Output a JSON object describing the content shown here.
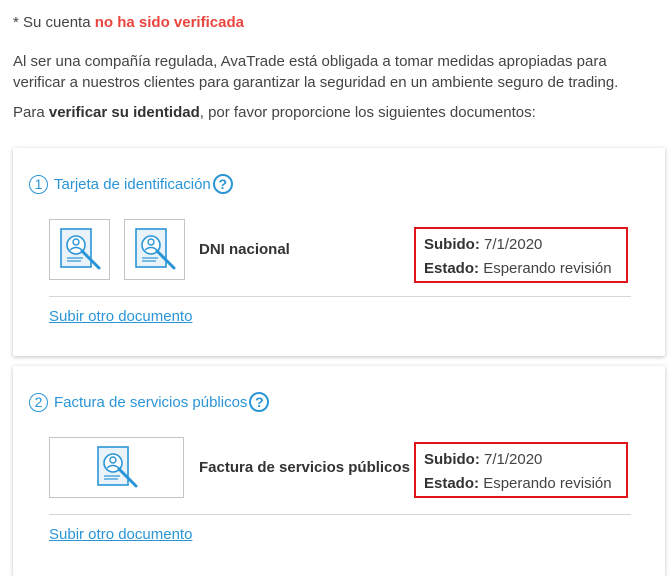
{
  "status": {
    "prefix": "* Su cuenta ",
    "warning": "no ha sido verificada"
  },
  "intro": "Al ser una compañía regulada, AvaTrade está obligada a tomar medidas apropiadas para verificar a nuestros clientes para garantizar la seguridad en un ambiente seguro de trading.",
  "request": {
    "before": "Para ",
    "bold": "verificar su identidad",
    "after": ", por favor proporcione los siguientes documentos:"
  },
  "sections": [
    {
      "number": "1",
      "title": "Tarjeta de identificación",
      "help": "?",
      "document_label": "DNI nacional",
      "uploaded_label": "Subido:",
      "uploaded_value": "7/1/2020",
      "state_label": "Estado:",
      "state_value": "Esperando revisión",
      "upload_link": "Subir otro documento"
    },
    {
      "number": "2",
      "title": "Factura de servicios públicos",
      "help": "?",
      "document_label": "Factura de servicios públicos",
      "uploaded_label": "Subido:",
      "uploaded_value": "7/1/2020",
      "state_label": "Estado:",
      "state_value": "Esperando revisión",
      "upload_link": "Subir otro documento"
    }
  ],
  "icons": {
    "document_thumbnail": "id-document-search-icon",
    "help": "help-icon"
  },
  "colors": {
    "accent": "#2a95d6",
    "warning": "#e8463f",
    "highlight_border": "#e0141b"
  }
}
